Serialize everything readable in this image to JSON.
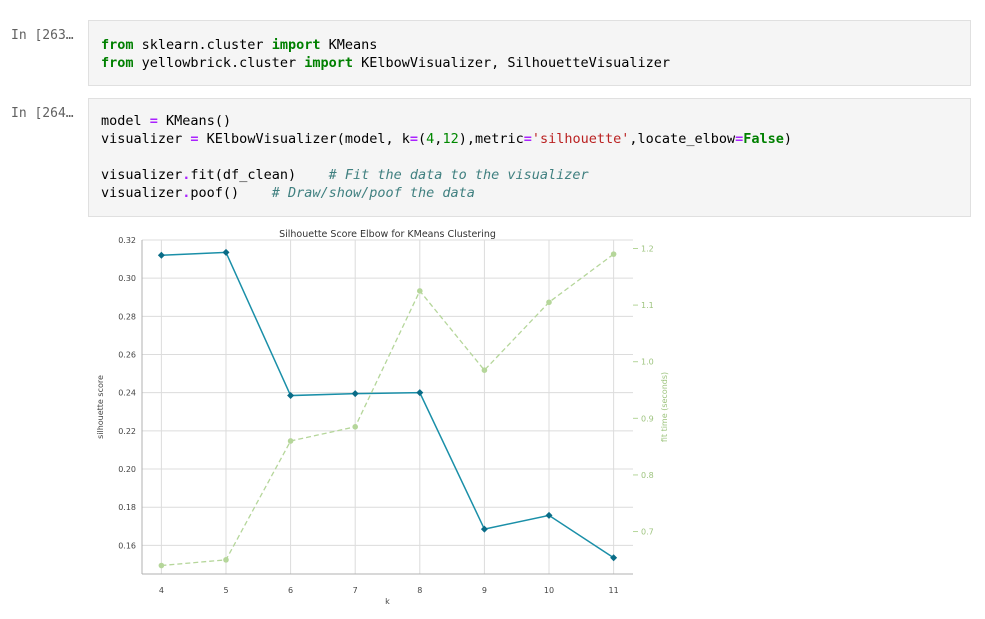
{
  "cells": [
    {
      "prompt": "In [263…",
      "lines": [
        [
          [
            "kw",
            "from"
          ],
          [
            "t",
            " sklearn.cluster "
          ],
          [
            "kw",
            "import"
          ],
          [
            "t",
            " KMeans"
          ]
        ],
        [
          [
            "kw",
            "from"
          ],
          [
            "t",
            " yellowbrick.cluster "
          ],
          [
            "kw",
            "import"
          ],
          [
            "t",
            " KElbowVisualizer, SilhouetteVisualizer"
          ]
        ]
      ]
    },
    {
      "prompt": "In [264…",
      "lines": [
        [
          [
            "t",
            "model "
          ],
          [
            "op",
            "="
          ],
          [
            "t",
            " KMeans()"
          ]
        ],
        [
          [
            "t",
            "visualizer "
          ],
          [
            "op",
            "="
          ],
          [
            "t",
            " KElbowVisualizer(model, k"
          ],
          [
            "op",
            "="
          ],
          [
            "t",
            "("
          ],
          [
            "num",
            "4"
          ],
          [
            "t",
            ","
          ],
          [
            "num",
            "12"
          ],
          [
            "t",
            "),metric"
          ],
          [
            "op",
            "="
          ],
          [
            "str",
            "'silhouette'"
          ],
          [
            "t",
            ",locate_elbow"
          ],
          [
            "op",
            "="
          ],
          [
            "bi",
            "False"
          ],
          [
            "t",
            ")"
          ]
        ],
        [
          [
            "t",
            ""
          ]
        ],
        [
          [
            "t",
            "visualizer"
          ],
          [
            "op",
            "."
          ],
          [
            "t",
            "fit(df_clean)    "
          ],
          [
            "cm",
            "# Fit the data to the visualizer"
          ]
        ],
        [
          [
            "t",
            "visualizer"
          ],
          [
            "op",
            "."
          ],
          [
            "t",
            "poof()    "
          ],
          [
            "cm",
            "# Draw/show/poof the data"
          ]
        ]
      ]
    }
  ],
  "chart_data": {
    "type": "line",
    "title": "Silhouette Score Elbow for KMeans Clustering",
    "xlabel": "k",
    "ylabel": "silhouette score",
    "y2label": "fit time (seconds)",
    "x": [
      4,
      5,
      6,
      7,
      8,
      9,
      10,
      11
    ],
    "series": [
      {
        "values": [
          0.312,
          0.3135,
          0.2385,
          0.2395,
          0.24,
          0.1685,
          0.1757,
          0.1535
        ],
        "color": "#1a8fa8",
        "axis": "left"
      },
      {
        "values": [
          0.64,
          0.65,
          0.86,
          0.885,
          1.125,
          0.985,
          1.105,
          1.19
        ],
        "color": "#b5d69a",
        "axis": "right"
      }
    ],
    "xticks": [
      "4",
      "5",
      "6",
      "7",
      "8",
      "9",
      "10",
      "11"
    ],
    "yticks": [
      "0.16",
      "0.18",
      "0.20",
      "0.22",
      "0.24",
      "0.26",
      "0.28",
      "0.30",
      "0.32"
    ],
    "y2ticks": [
      "0.7",
      "0.8",
      "0.9",
      "1.0",
      "1.1",
      "1.2"
    ],
    "xlim": [
      3.7,
      11.3
    ],
    "ylim": [
      0.145,
      0.32
    ],
    "y2lim": [
      0.625,
      1.215
    ],
    "grid": true
  }
}
